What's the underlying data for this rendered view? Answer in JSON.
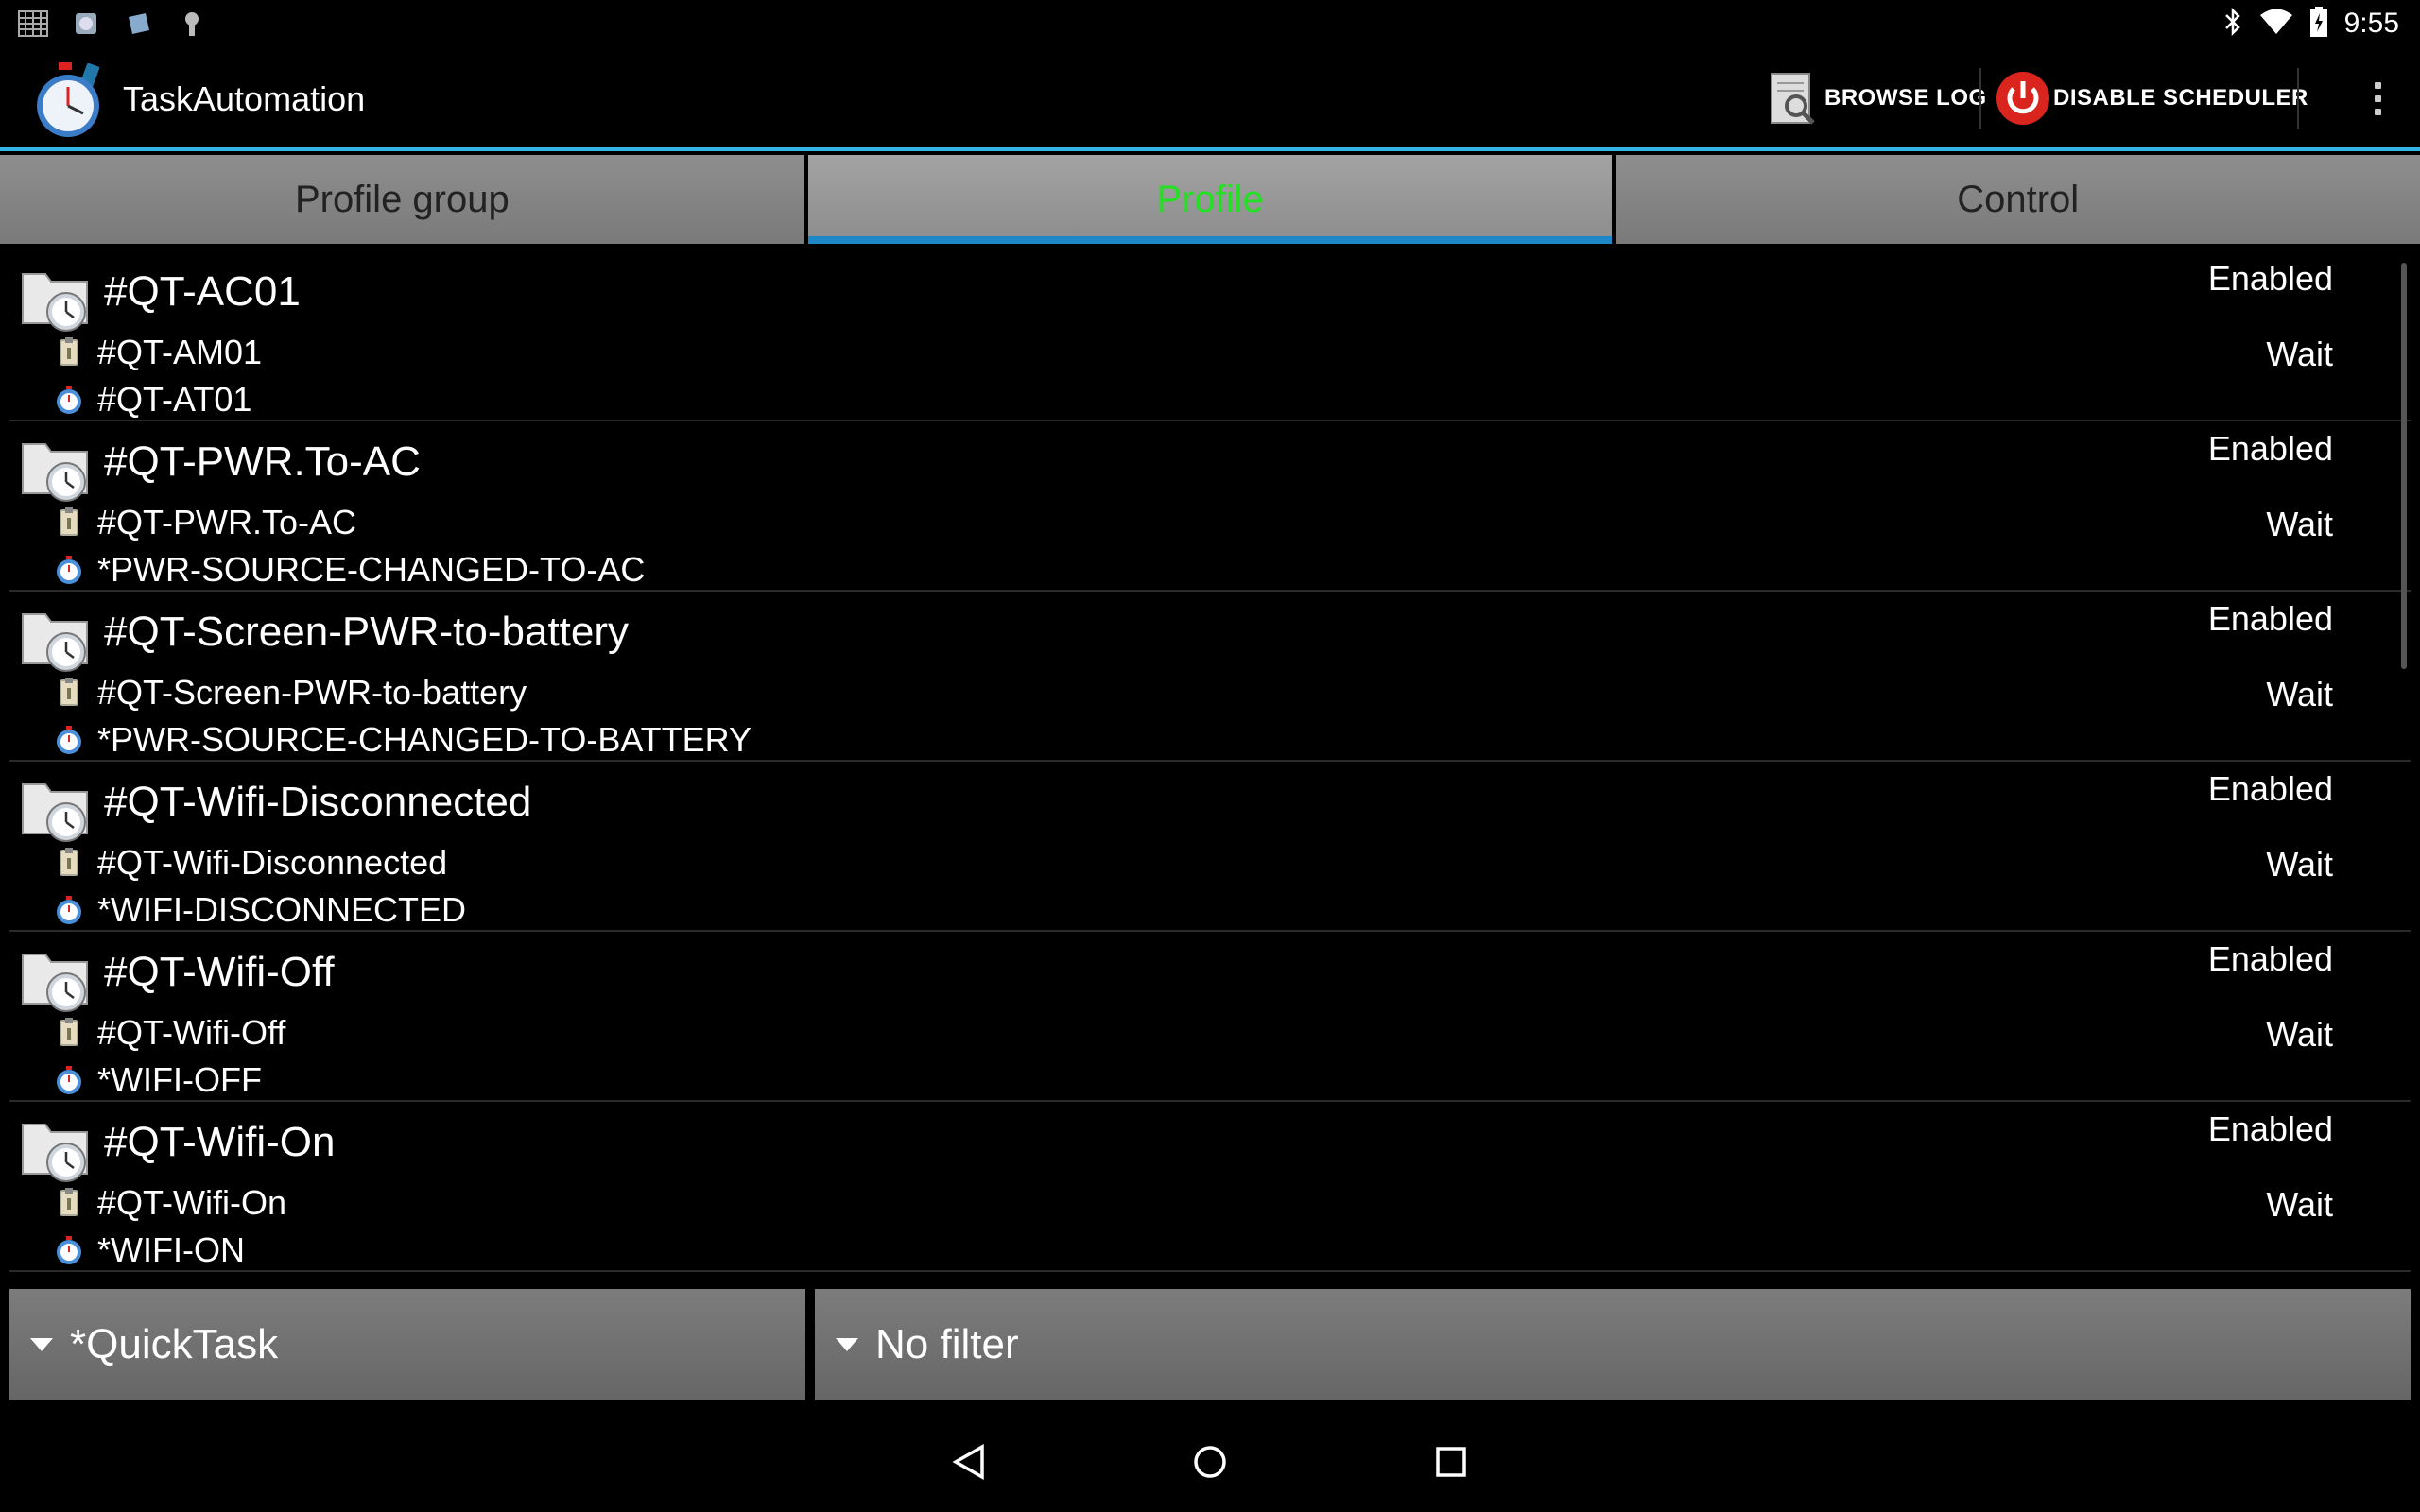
{
  "status_bar": {
    "left_icons": [
      "keyboard-grid-icon",
      "app-notify-icon",
      "store-notify-icon",
      "android-debug-icon"
    ],
    "right_icons": [
      "bluetooth-icon",
      "wifi-icon",
      "battery-charging-icon"
    ],
    "time": "9:55"
  },
  "action_bar": {
    "app_title": "TaskAutomation",
    "browse_log_label": "BROWSE LOG",
    "disable_scheduler_label": "DISABLE SCHEDULER"
  },
  "tabs": [
    {
      "label": "Profile group",
      "active": false
    },
    {
      "label": "Profile",
      "active": true
    },
    {
      "label": "Control",
      "active": false
    }
  ],
  "profiles": [
    {
      "name": "#QT-AC01",
      "status": "Enabled",
      "task": "#QT-AM01",
      "task_status": "Wait",
      "trigger": "#QT-AT01"
    },
    {
      "name": "#QT-PWR.To-AC",
      "status": "Enabled",
      "task": "#QT-PWR.To-AC",
      "task_status": "Wait",
      "trigger": "*PWR-SOURCE-CHANGED-TO-AC"
    },
    {
      "name": "#QT-Screen-PWR-to-battery",
      "status": "Enabled",
      "task": "#QT-Screen-PWR-to-battery",
      "task_status": "Wait",
      "trigger": "*PWR-SOURCE-CHANGED-TO-BATTERY"
    },
    {
      "name": "#QT-Wifi-Disconnected",
      "status": "Enabled",
      "task": "#QT-Wifi-Disconnected",
      "task_status": "Wait",
      "trigger": "*WIFI-DISCONNECTED"
    },
    {
      "name": "#QT-Wifi-Off",
      "status": "Enabled",
      "task": "#QT-Wifi-Off",
      "task_status": "Wait",
      "trigger": "*WIFI-OFF"
    },
    {
      "name": "#QT-Wifi-On",
      "status": "Enabled",
      "task": "#QT-Wifi-On",
      "task_status": "Wait",
      "trigger": "*WIFI-ON"
    }
  ],
  "filters": {
    "group_selected": "*QuickTask",
    "filter_selected": "No filter"
  },
  "colors": {
    "accent": "#33b5e5",
    "active_tab_text": "#22e022",
    "tab_indicator": "#1d87c8"
  }
}
